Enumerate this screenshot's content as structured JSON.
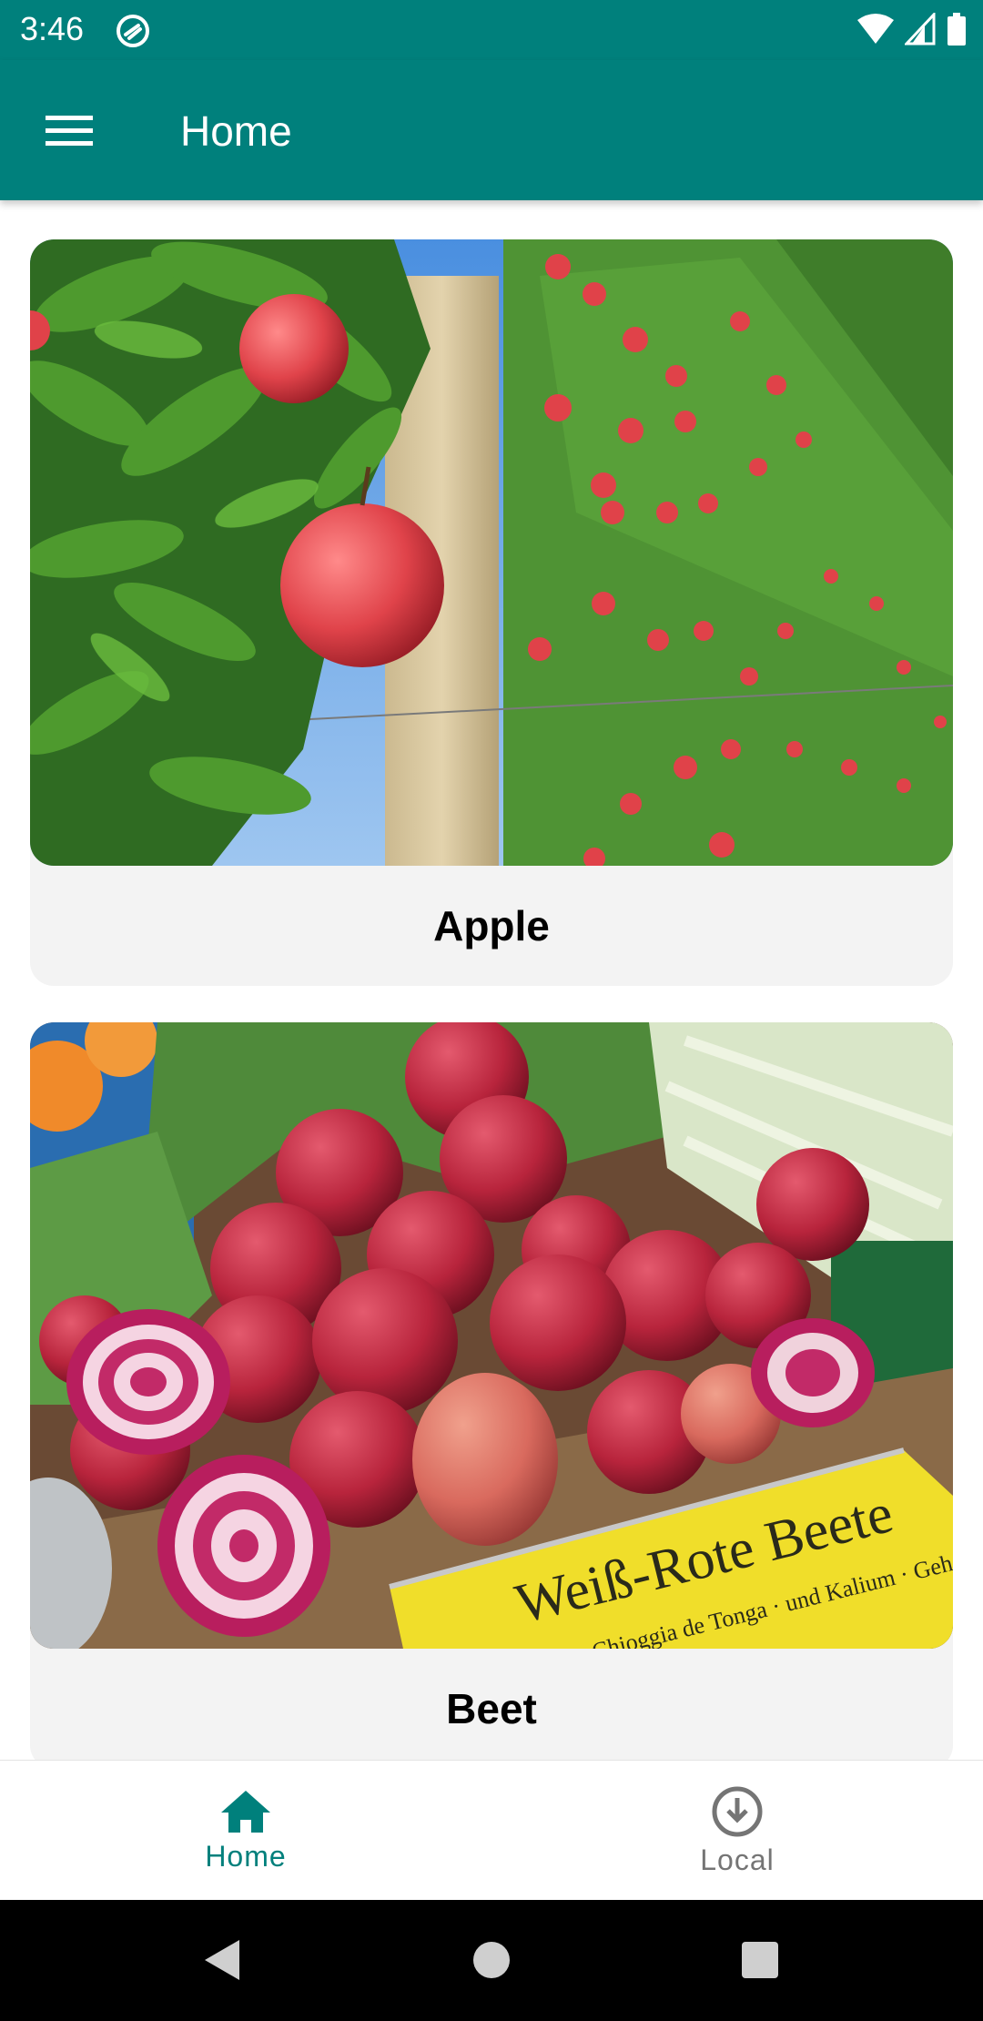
{
  "status_bar": {
    "time": "3:46",
    "icons": [
      "app-notification-icon",
      "wifi-icon",
      "signal-icon",
      "battery-icon"
    ]
  },
  "app_bar": {
    "title": "Home",
    "menu_icon": "hamburger-menu-icon"
  },
  "cards": [
    {
      "title": "Apple",
      "image": "apple-orchard-photo"
    },
    {
      "title": "Beet",
      "image": "beets-market-photo",
      "sign_text": "Weiß-Rote Beete",
      "sign_subtext": "Chioggia de Tonga · und Kalium · Gehalt"
    }
  ],
  "bottom_nav": {
    "items": [
      {
        "label": "Home",
        "icon": "home-icon",
        "active": true
      },
      {
        "label": "Local",
        "icon": "download-circle-icon",
        "active": false
      }
    ]
  },
  "colors": {
    "primary": "#00807c",
    "card_bg": "#f3f3f3",
    "inactive": "#757575"
  }
}
